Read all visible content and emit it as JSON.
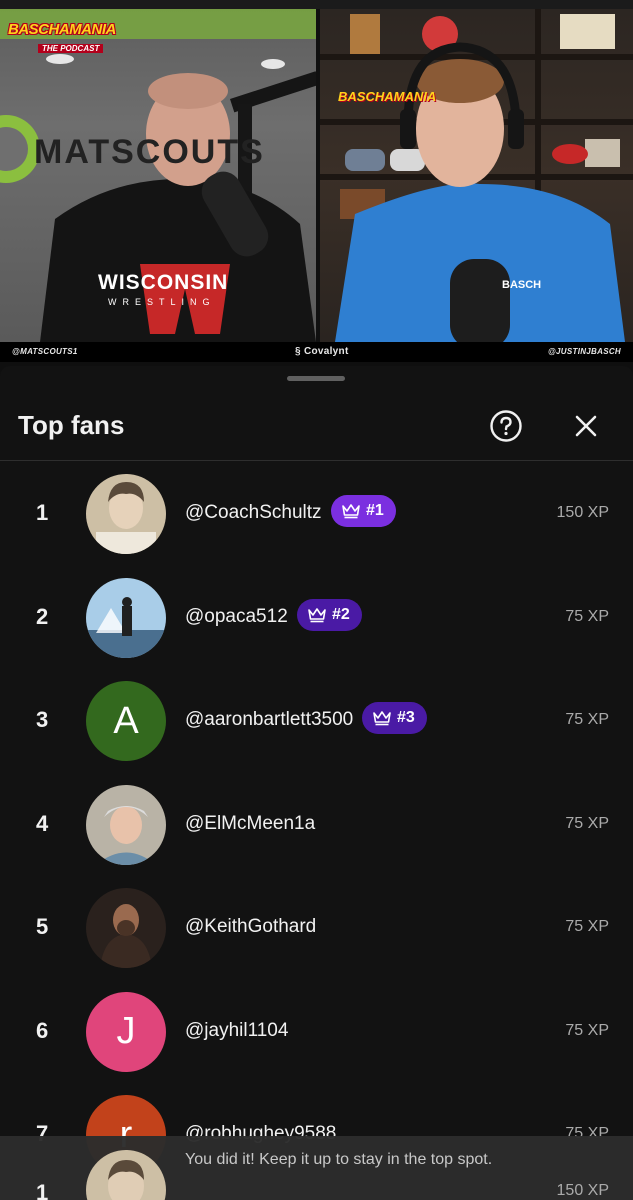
{
  "video": {
    "logo_title": "BASCHAMANIA",
    "logo_subtitle": "THE PODCAST",
    "wall_logo": "MATSCOUTS",
    "shirt_text": "WISCONSIN",
    "shirt_sub": "WRESTLING",
    "shirt_text_right": "BASCH",
    "left_handle": "@MATSCOUTS1",
    "sponsor": "Covalynt",
    "right_handle": "@JUSTINJBASCH"
  },
  "sheet": {
    "title": "Top fans",
    "help_icon": "help-circle-icon",
    "close_icon": "close-icon"
  },
  "fans": [
    {
      "rank": "1",
      "name": "@CoachSchultz",
      "badge": "#1",
      "xp": "150 XP",
      "avatar_type": "photo",
      "avatar_color": "#cdbfa5"
    },
    {
      "rank": "2",
      "name": "@opaca512",
      "badge": "#2",
      "xp": "75 XP",
      "avatar_type": "photo",
      "avatar_color": "#a9cde8"
    },
    {
      "rank": "3",
      "name": "@aaronbartlett3500",
      "badge": "#3",
      "xp": "75 XP",
      "avatar_type": "letter",
      "letter": "A",
      "avatar_color": "#33691e"
    },
    {
      "rank": "4",
      "name": "@ElMcMeen1a",
      "badge": "",
      "xp": "75 XP",
      "avatar_type": "photo",
      "avatar_color": "#b9b3a6"
    },
    {
      "rank": "5",
      "name": "@KeithGothard",
      "badge": "",
      "xp": "75 XP",
      "avatar_type": "photo",
      "avatar_color": "#2a211d"
    },
    {
      "rank": "6",
      "name": "@jayhil1104",
      "badge": "",
      "xp": "75 XP",
      "avatar_type": "letter",
      "letter": "J",
      "avatar_color": "#e0457b"
    },
    {
      "rank": "7",
      "name": "@robhughey9588",
      "badge": "",
      "xp": "75 XP",
      "avatar_type": "letter",
      "letter": "r",
      "avatar_color": "#c2421b"
    }
  ],
  "badge_colors": {
    "#1": "#7b2fe0",
    "#2": "#4a1aa5",
    "#3": "#4a1aa5"
  },
  "toast": {
    "message": "You did it! Keep it up to stay in the top spot.",
    "rank": "1",
    "xp": "150 XP"
  }
}
